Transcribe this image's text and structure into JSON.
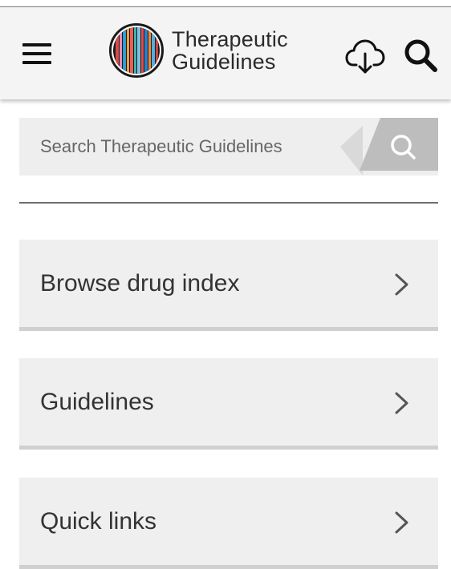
{
  "header": {
    "logo_line1": "Therapeutic",
    "logo_line2": "Guidelines",
    "icons": {
      "menu": "hamburger-menu-icon",
      "download": "cloud-download-icon",
      "search": "search-icon"
    }
  },
  "search": {
    "placeholder": "Search Therapeutic Guidelines",
    "value": ""
  },
  "nav": {
    "items": [
      {
        "label": "Browse drug index"
      },
      {
        "label": "Guidelines"
      },
      {
        "label": "Quick links"
      }
    ]
  },
  "colors": {
    "header_bg": "#f4f4f4",
    "card_bg": "#efefef",
    "search_button": "#b9b9b9",
    "text": "#333333"
  }
}
